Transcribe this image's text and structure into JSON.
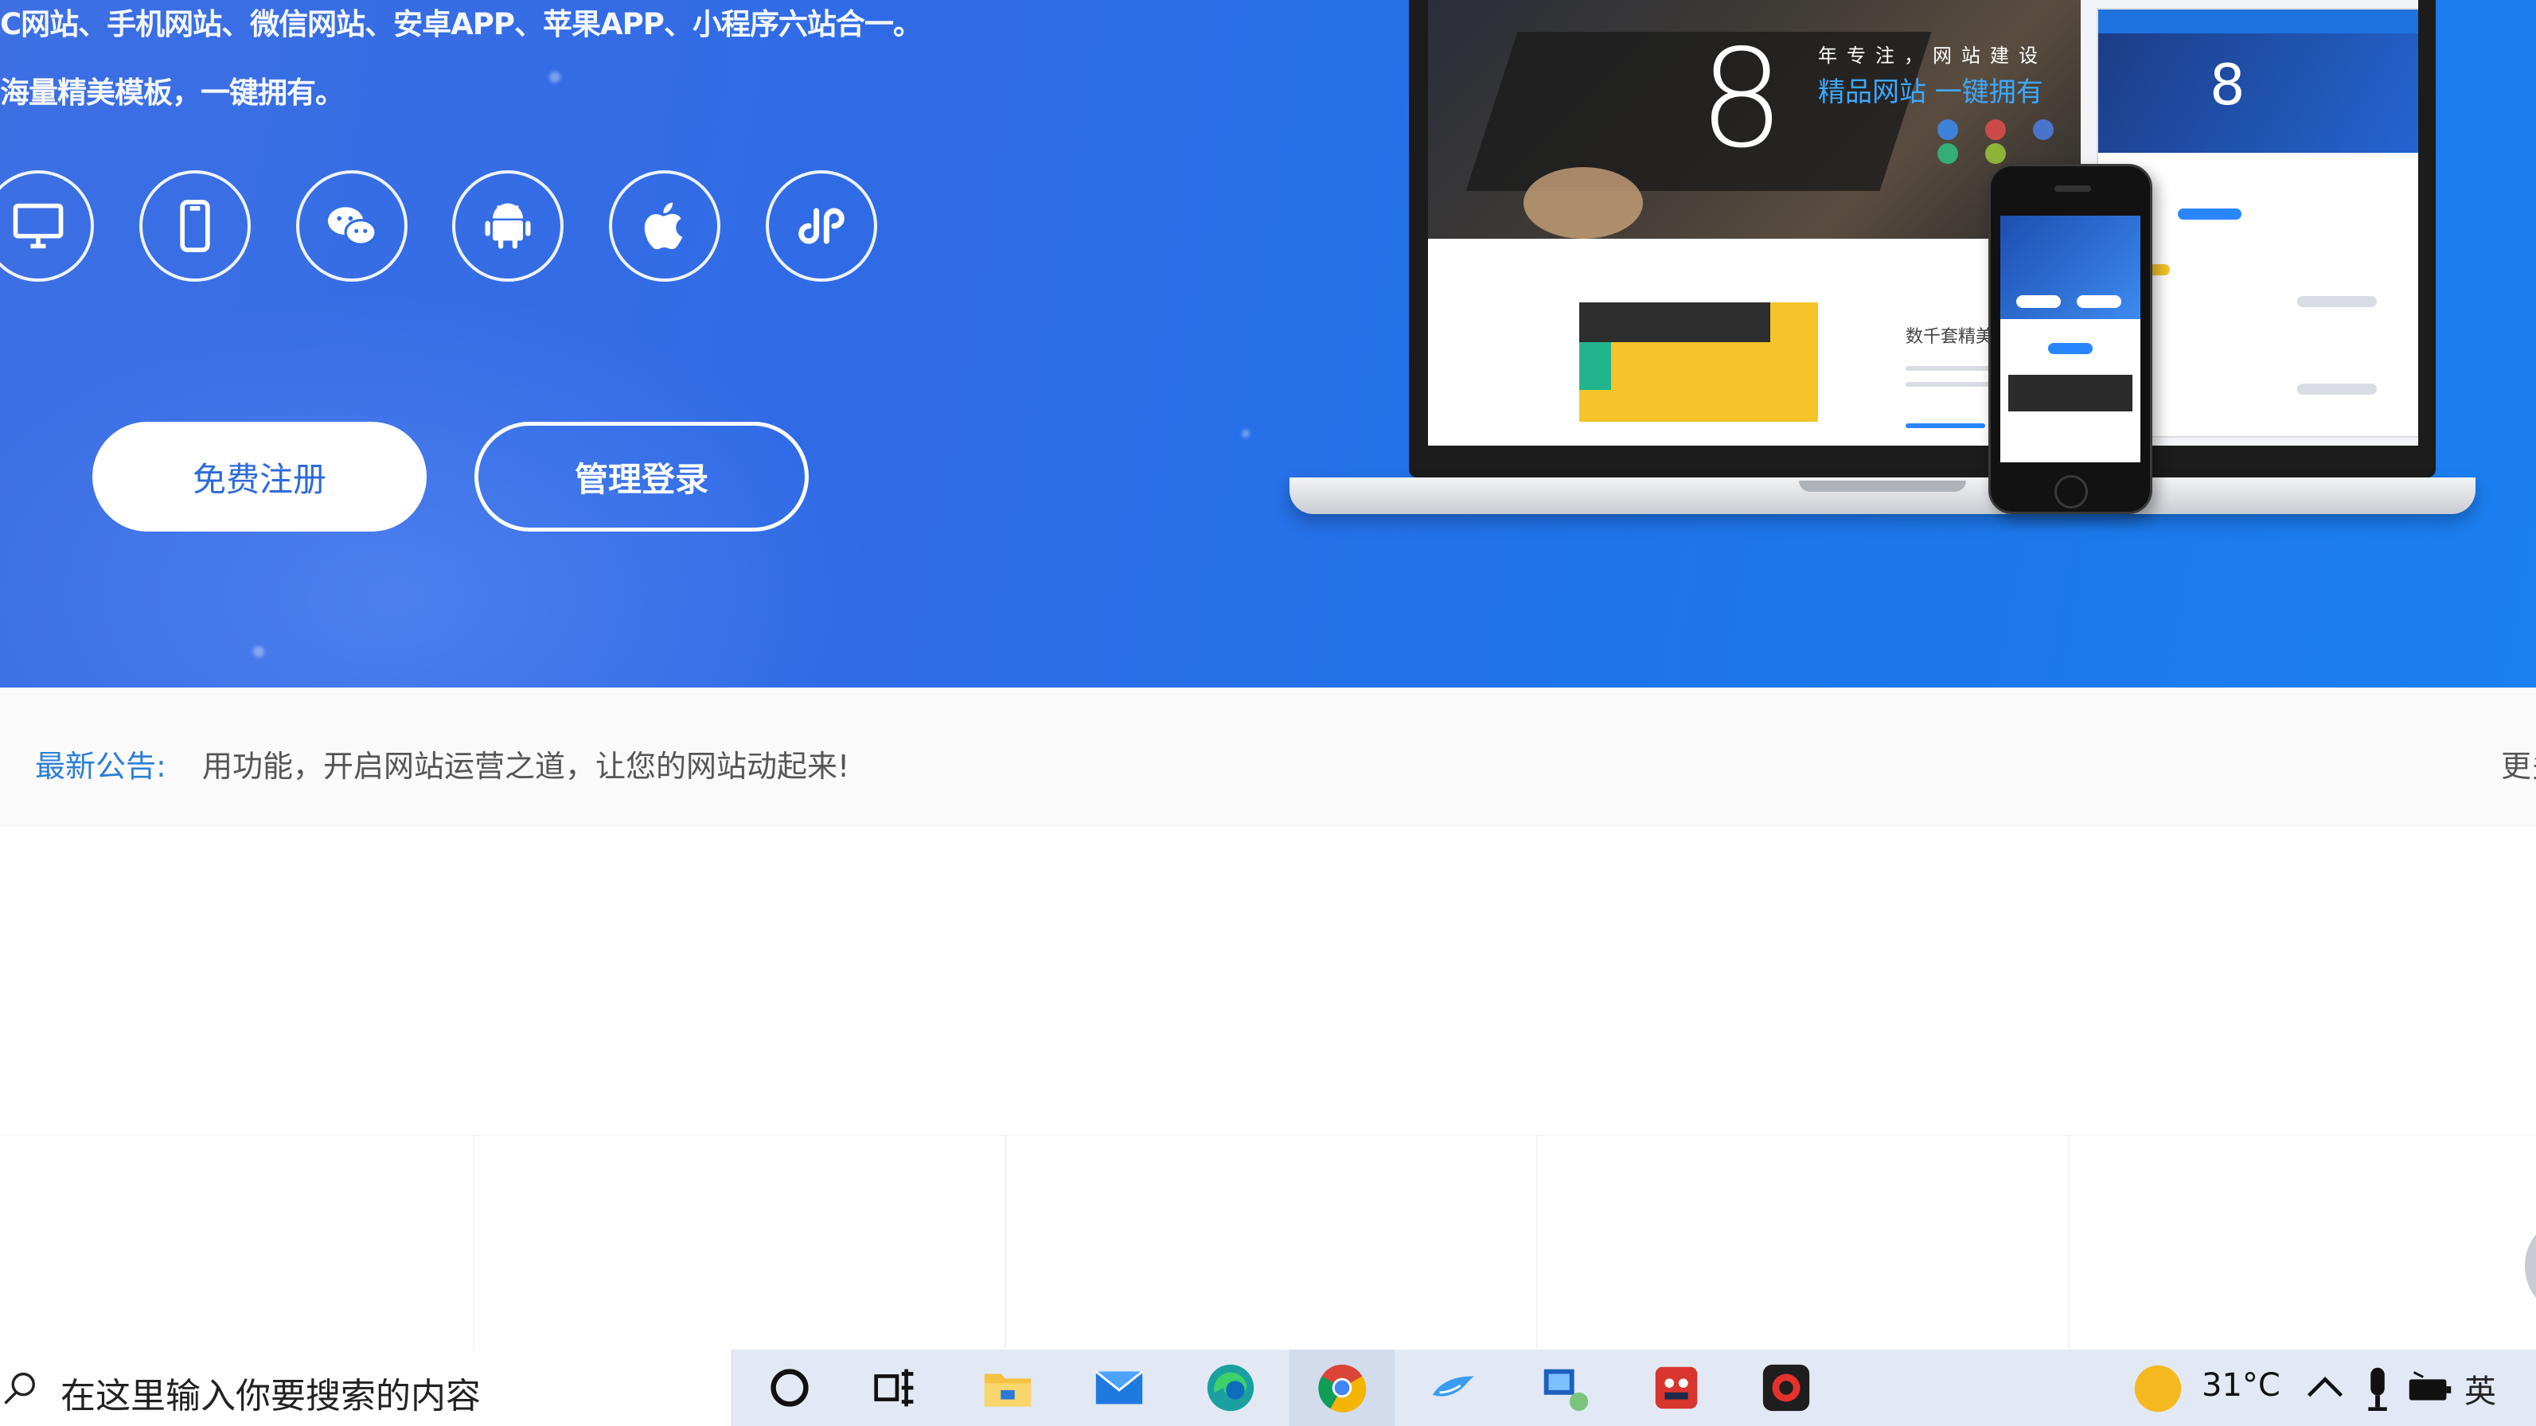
{
  "hero": {
    "line1": "C网站、手机网站、微信网站、安卓APP、苹果APP、小程序六站合一。",
    "line2": "海量精美模板，一键拥有。",
    "platforms": [
      {
        "name": "pc",
        "icon": "monitor-icon"
      },
      {
        "name": "mobile",
        "icon": "phone-icon"
      },
      {
        "name": "wechat",
        "icon": "wechat-icon"
      },
      {
        "name": "android",
        "icon": "android-icon"
      },
      {
        "name": "apple",
        "icon": "apple-icon"
      },
      {
        "name": "miniprogram",
        "icon": "mini-program-icon"
      }
    ],
    "register_label": "免费注册",
    "login_label": "管理登录",
    "mockup": {
      "big_number": "8",
      "slogan_top": "年专注，网站建设",
      "slogan_bottom": "精品网站 一键拥有",
      "side_text": "数千套精美"
    }
  },
  "notice": {
    "label": "最新公告:",
    "text": "用功能，开启网站运营之道，让您的网站动起来!",
    "more": "更多"
  },
  "taskbar": {
    "search_placeholder": "在这里输入你要搜索的内容",
    "apps": [
      "cortana-icon",
      "task-view-icon",
      "file-explorer-icon",
      "mail-icon",
      "edge-icon",
      "chrome-icon",
      "bird-app-icon",
      "remote-desktop-icon",
      "red-app-icon",
      "recorder-icon"
    ],
    "temperature": "31°C",
    "ime": "英",
    "colors": {
      "accent": "#2b7fd6",
      "hero_blue": "#2f6be6"
    }
  }
}
